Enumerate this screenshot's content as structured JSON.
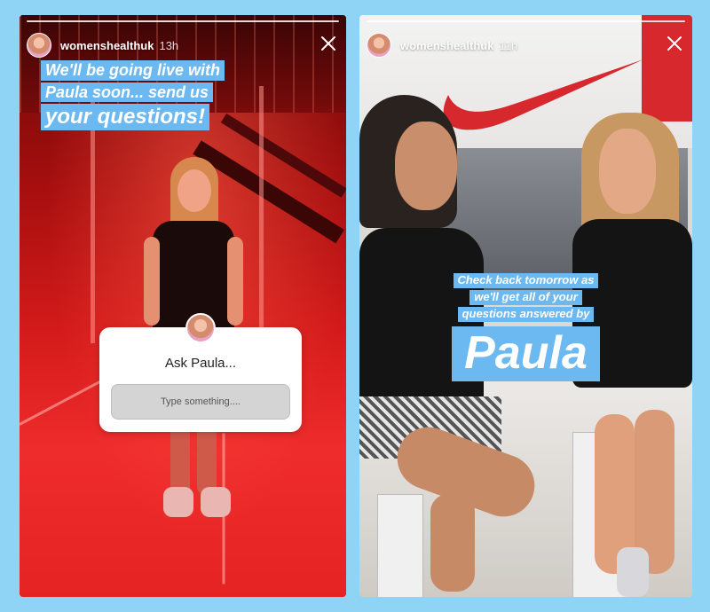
{
  "background_color": "#8fd3f5",
  "caption_color": "#6cb8f0",
  "stories": [
    {
      "username": "womenshealthuk",
      "time": "13h",
      "avatar_icon": "profile-avatar",
      "close_icon": "close-icon",
      "caption_lines": [
        "We'll be going live with",
        "Paula soon... send us",
        "your questions!"
      ],
      "question_sticker": {
        "title": "Ask Paula...",
        "placeholder": "Type something...."
      }
    },
    {
      "username": "womenshealthuk",
      "time": "11h",
      "avatar_icon": "profile-avatar",
      "close_icon": "close-icon",
      "caption_lines": [
        "Check back tomorrow as",
        "we'll get all of your",
        "questions answered by"
      ],
      "caption_big": "Paula"
    }
  ]
}
